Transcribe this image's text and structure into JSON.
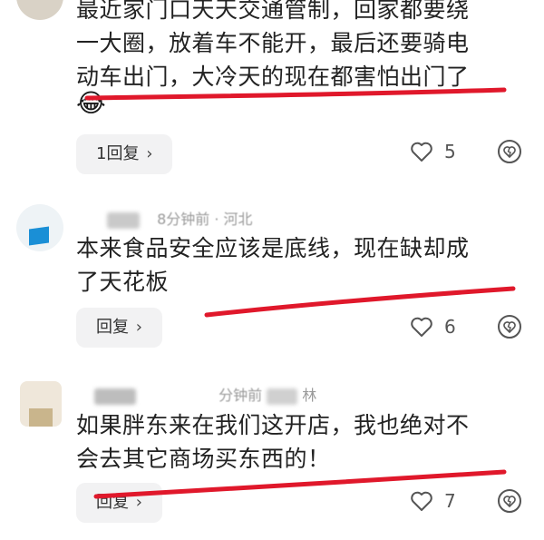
{
  "comments": [
    {
      "text_lines": [
        "最近家门口天天交通管制，回家都要绕",
        "一大圈，放着车不能开，最后还要骑电",
        "动车出门，大冷天的现在都害怕出门了"
      ],
      "emoji": "😂",
      "reply_label": "1回复",
      "likes": "5"
    },
    {
      "author_meta": "8分钟前 · 河北",
      "text_lines": [
        "本来食品安全应该是底线，现在缺却成",
        "了天花板"
      ],
      "reply_label": "回复",
      "likes": "6"
    },
    {
      "author_meta": "分钟前",
      "author_name_tail": "林",
      "text_lines": [
        "如果胖东来在我们这开店，我也绝对不",
        "会去其它商场买东西的！"
      ],
      "reply_label": "回复",
      "likes": "7"
    }
  ],
  "icons": {
    "reply_chevron": "chevron-right-icon",
    "like": "heart-outline-icon",
    "dislike": "broken-heart-icon"
  },
  "colors": {
    "annotation": "#e0182b",
    "pill_bg": "#f2f2f3"
  }
}
